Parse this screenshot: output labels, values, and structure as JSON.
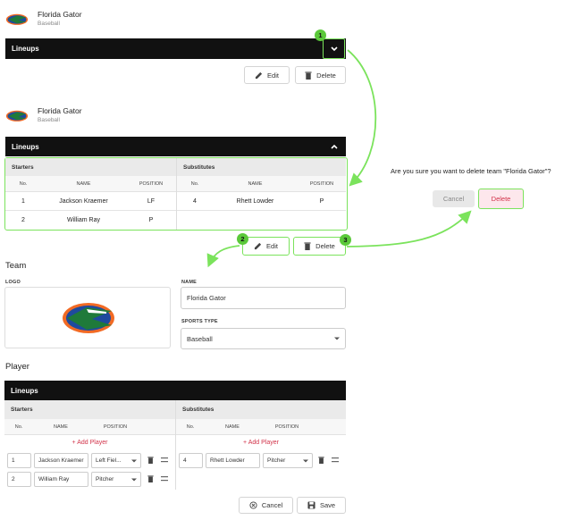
{
  "team": {
    "name": "Florida Gator",
    "sport": "Baseball"
  },
  "lineups": {
    "label": "Lineups"
  },
  "buttons": {
    "edit": "Edit",
    "delete": "Delete",
    "cancel": "Cancel",
    "save": "Save"
  },
  "badges": [
    "1",
    "2",
    "3"
  ],
  "table": {
    "starters_label": "Starters",
    "substitutes_label": "Substitutes",
    "col_no": "No.",
    "col_name": "NAME",
    "col_position": "POSITION",
    "starters": [
      {
        "no": "1",
        "name": "Jackson Kraemer",
        "position": "LF"
      },
      {
        "no": "2",
        "name": "William Ray",
        "position": "P"
      }
    ],
    "substitutes": [
      {
        "no": "4",
        "name": "Rhett Lowder",
        "position": "P"
      }
    ]
  },
  "dialog": {
    "message": "Are you sure you want to delete team \"Florida Gator\"?",
    "cancel": "Cancel",
    "delete": "Delete"
  },
  "form": {
    "team_heading": "Team",
    "logo_label": "LOGO",
    "name_label": "NAME",
    "name_value": "Florida Gator",
    "sports_type_label": "SPORTS TYPE",
    "sports_type_value": "Baseball",
    "player_heading": "Player",
    "add_player": "+ Add Player",
    "starters": [
      {
        "no": "1",
        "name": "Jackson Kraemer",
        "position": "Left Fiel..."
      },
      {
        "no": "2",
        "name": "William Ray",
        "position": "Pitcher"
      }
    ],
    "substitutes": [
      {
        "no": "4",
        "name": "Rhett Lowder",
        "position": "Pitcher"
      }
    ]
  },
  "colors": {
    "highlight": "#7be35c",
    "badge": "#5bc93a",
    "danger": "#d2334a",
    "bar": "#111111"
  },
  "icons": [
    "gator-logo",
    "chevron-down-icon",
    "chevron-up-icon",
    "pencil-icon",
    "trash-icon",
    "cancel-circle-icon",
    "save-icon",
    "drag-handle-icon",
    "caret-down-icon"
  ]
}
